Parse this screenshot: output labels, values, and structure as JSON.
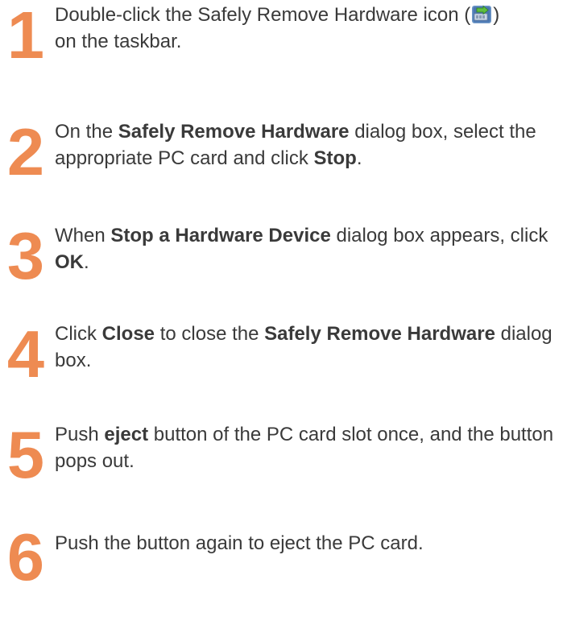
{
  "steps": [
    {
      "number": "1",
      "parts": [
        "Double-click the Safely Remove Hardware icon (",
        ")",
        "on the taskbar."
      ],
      "icon": "safely-remove-hardware-icon"
    },
    {
      "number": "2",
      "parts": [
        "On the ",
        "Safely Remove Hardware",
        " dialog box, select the appropriate PC card and click ",
        "Stop",
        "."
      ]
    },
    {
      "number": "3",
      "parts": [
        "When ",
        "Stop a Hardware Device",
        " dialog box appears, click ",
        "OK",
        "."
      ]
    },
    {
      "number": "4",
      "parts": [
        "Click ",
        "Close",
        " to close the ",
        "Safely Remove Hardware",
        " dialog box."
      ]
    },
    {
      "number": "5",
      "parts": [
        "Push ",
        "eject",
        " button of the PC card slot once, and the button pops out."
      ]
    },
    {
      "number": "6",
      "parts": [
        "Push the button again to eject the PC card."
      ]
    }
  ],
  "colors": {
    "step_number": "#ee8b52",
    "text": "#3a3a3a"
  }
}
